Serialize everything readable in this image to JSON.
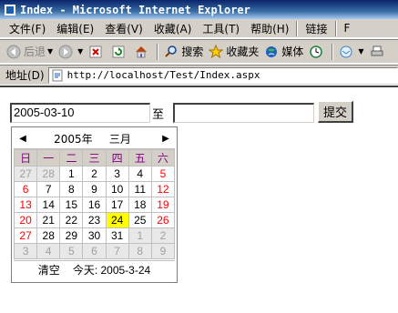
{
  "window": {
    "title": "Index - Microsoft Internet Explorer"
  },
  "menu": {
    "items": [
      "文件(F)",
      "编辑(E)",
      "查看(V)",
      "收藏(A)",
      "工具(T)",
      "帮助(H)"
    ],
    "links": "链接",
    "extra": "F"
  },
  "toolbar": {
    "back": "后退",
    "search": "搜索",
    "favorites": "收藏夹",
    "media": "媒体"
  },
  "address": {
    "label": "地址(D)",
    "url": "http://localhost/Test/Index.aspx"
  },
  "form": {
    "date_value": "2005-03-10",
    "to_label": "至",
    "text_value": "",
    "submit_label": "提交"
  },
  "calendar": {
    "year_label": "2005年",
    "month_label": "三月",
    "weekdays": [
      "日",
      "一",
      "二",
      "三",
      "四",
      "五",
      "六"
    ],
    "weeks": [
      [
        {
          "d": "27",
          "o": true
        },
        {
          "d": "28",
          "o": true
        },
        {
          "d": "1"
        },
        {
          "d": "2"
        },
        {
          "d": "3"
        },
        {
          "d": "4"
        },
        {
          "d": "5"
        }
      ],
      [
        {
          "d": "6"
        },
        {
          "d": "7"
        },
        {
          "d": "8"
        },
        {
          "d": "9"
        },
        {
          "d": "10"
        },
        {
          "d": "11"
        },
        {
          "d": "12"
        }
      ],
      [
        {
          "d": "13"
        },
        {
          "d": "14"
        },
        {
          "d": "15"
        },
        {
          "d": "16"
        },
        {
          "d": "17"
        },
        {
          "d": "18"
        },
        {
          "d": "19"
        }
      ],
      [
        {
          "d": "20"
        },
        {
          "d": "21"
        },
        {
          "d": "22"
        },
        {
          "d": "23"
        },
        {
          "d": "24",
          "today": true
        },
        {
          "d": "25"
        },
        {
          "d": "26"
        }
      ],
      [
        {
          "d": "27"
        },
        {
          "d": "28"
        },
        {
          "d": "29"
        },
        {
          "d": "30"
        },
        {
          "d": "31"
        },
        {
          "d": "1",
          "o": true
        },
        {
          "d": "2",
          "o": true
        }
      ],
      [
        {
          "d": "3",
          "o": true
        },
        {
          "d": "4",
          "o": true
        },
        {
          "d": "5",
          "o": true
        },
        {
          "d": "6",
          "o": true
        },
        {
          "d": "7",
          "o": true
        },
        {
          "d": "8",
          "o": true
        },
        {
          "d": "9",
          "o": true
        }
      ]
    ],
    "clear_label": "清空",
    "today_label": "今天: 2005-3-24",
    "colors": {
      "weekday_header": "#800080",
      "weekend": "#ff0000",
      "today_highlight": "#ffff00",
      "other_month": "#a0a0a0"
    }
  }
}
